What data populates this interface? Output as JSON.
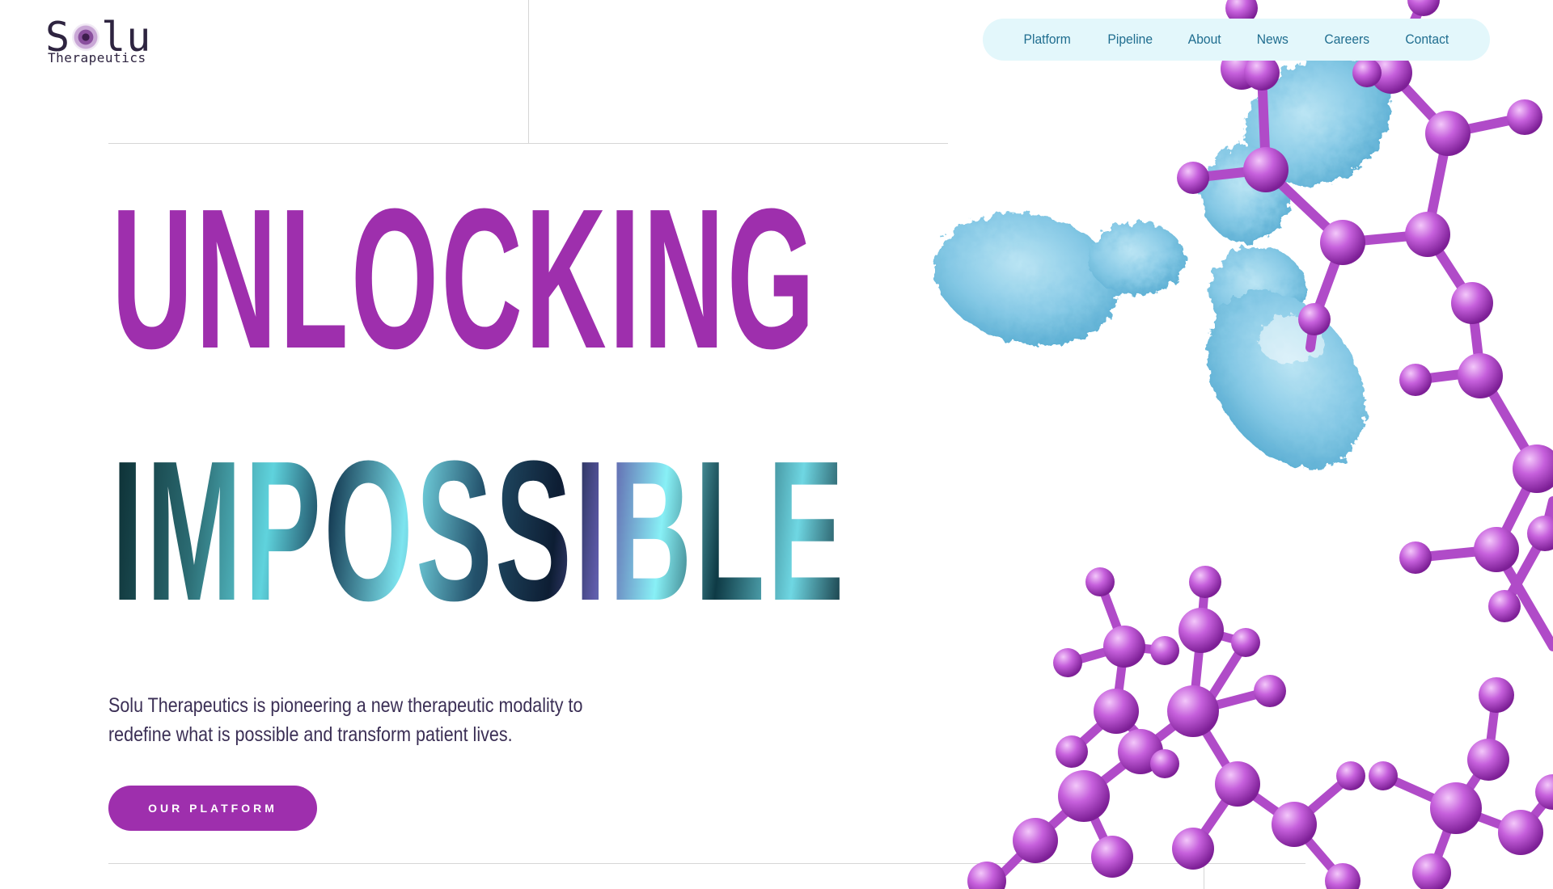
{
  "logo": {
    "text_before": "S",
    "text_after": "lu",
    "subtitle": "Therapeutics"
  },
  "nav": {
    "items": [
      "Platform",
      "Pipeline",
      "About",
      "News",
      "Careers",
      "Contact"
    ]
  },
  "hero": {
    "line1": "UNLOCKING",
    "line2": "IMPOSSIBLE",
    "tagline": "Solu Therapeutics is pioneering a new therapeutic modality to redefine what is possible and transform patient lives.",
    "cta_label": "OUR PLATFORM"
  },
  "colors": {
    "brand_purple": "#9e2fad",
    "nav_bg": "#e3f7fb",
    "nav_text": "#1f6d8f",
    "antibody_blue": "#7fc6e4",
    "molecule_purple": "#b04bc8"
  },
  "icons": [
    "logo-cell-icon",
    "antibody-illustration",
    "molecule-illustration"
  ]
}
